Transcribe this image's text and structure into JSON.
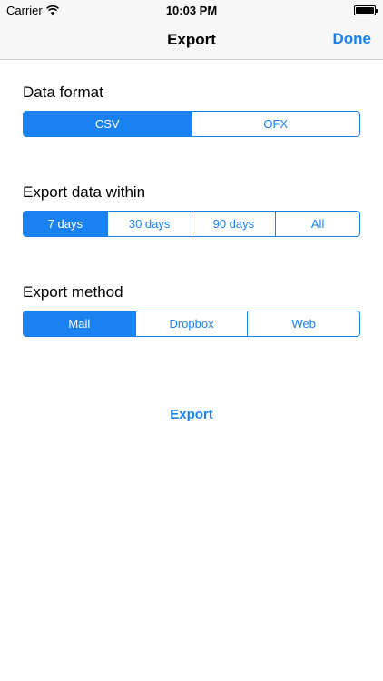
{
  "status_bar": {
    "carrier": "Carrier",
    "time": "10:03 PM",
    "icons": [
      "wifi-icon",
      "battery-icon"
    ]
  },
  "nav": {
    "title": "Export",
    "done_label": "Done"
  },
  "sections": {
    "data_format": {
      "label": "Data format",
      "options": [
        "CSV",
        "OFX"
      ],
      "selected": "CSV"
    },
    "export_within": {
      "label": "Export data within",
      "options": [
        "7 days",
        "30 days",
        "90 days",
        "All"
      ],
      "selected": "7 days"
    },
    "export_method": {
      "label": "Export method",
      "options": [
        "Mail",
        "Dropbox",
        "Web"
      ],
      "selected": "Mail"
    }
  },
  "export_label": "Export",
  "colors": {
    "accent": "#1a82f0",
    "bar_background": "#f7f7f7"
  }
}
